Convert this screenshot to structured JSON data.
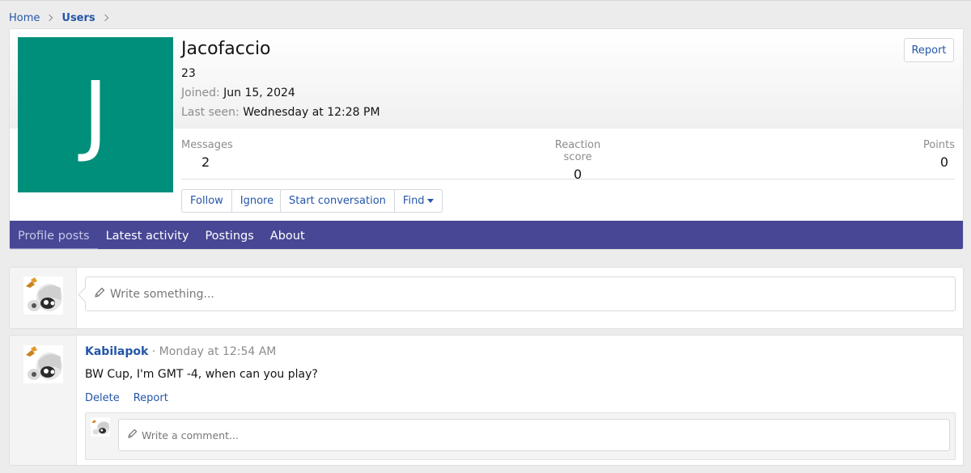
{
  "breadcrumb": {
    "home": "Home",
    "users": "Users"
  },
  "profile": {
    "avatar_letter": "J",
    "avatar_color": "#008f7a",
    "username": "Jacofaccio",
    "title": "23",
    "joined_label": "Joined:",
    "joined_value": "Jun 15, 2024",
    "last_seen_label": "Last seen:",
    "last_seen_value": "Wednesday at 12:28 PM",
    "report_label": "Report",
    "stats": [
      {
        "label": "Messages",
        "value": "2"
      },
      {
        "label": "Reaction score",
        "value": "0"
      },
      {
        "label": "Points",
        "value": "0"
      }
    ],
    "buttons": {
      "follow": "Follow",
      "ignore": "Ignore",
      "start_conversation": "Start conversation",
      "find": "Find"
    }
  },
  "tabs": [
    {
      "label": "Profile posts",
      "active": true
    },
    {
      "label": "Latest activity",
      "active": false
    },
    {
      "label": "Postings",
      "active": false
    },
    {
      "label": "About",
      "active": false
    }
  ],
  "composer": {
    "placeholder": "Write something..."
  },
  "post": {
    "author": "Kabilapok",
    "separator": " · ",
    "time": "Monday at 12:54 AM",
    "body": "BW Cup, I'm GMT -4, when can you play?",
    "delete_label": "Delete",
    "report_label": "Report",
    "comment_placeholder": "Write a comment..."
  },
  "colors": {
    "accent": "#474795",
    "link": "#2456a8"
  }
}
